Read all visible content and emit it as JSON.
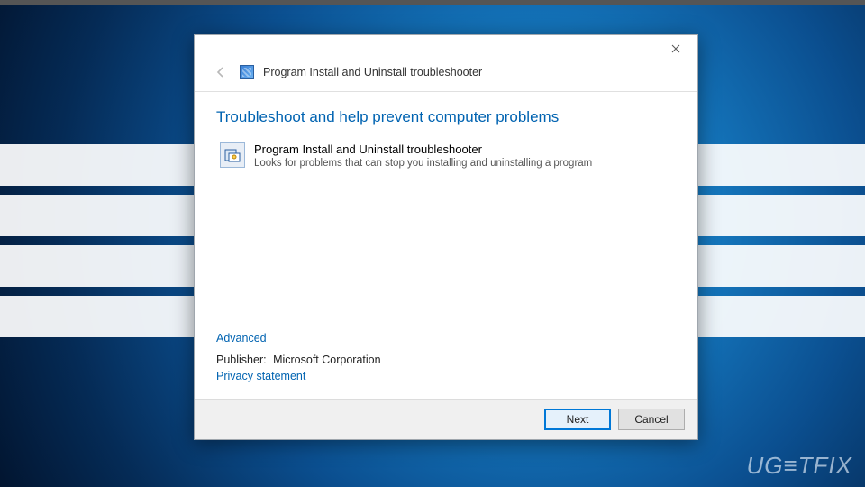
{
  "window": {
    "title": "Program Install and Uninstall troubleshooter"
  },
  "headline": "Troubleshoot and help prevent computer problems",
  "item": {
    "title": "Program Install and Uninstall troubleshooter",
    "description": "Looks for problems that can stop you installing and uninstalling a program"
  },
  "links": {
    "advanced": "Advanced",
    "privacy": "Privacy statement"
  },
  "publisher": {
    "label": "Publisher:",
    "value": "Microsoft Corporation"
  },
  "buttons": {
    "next": "Next",
    "cancel": "Cancel"
  },
  "watermark": "UG≡TFIX"
}
